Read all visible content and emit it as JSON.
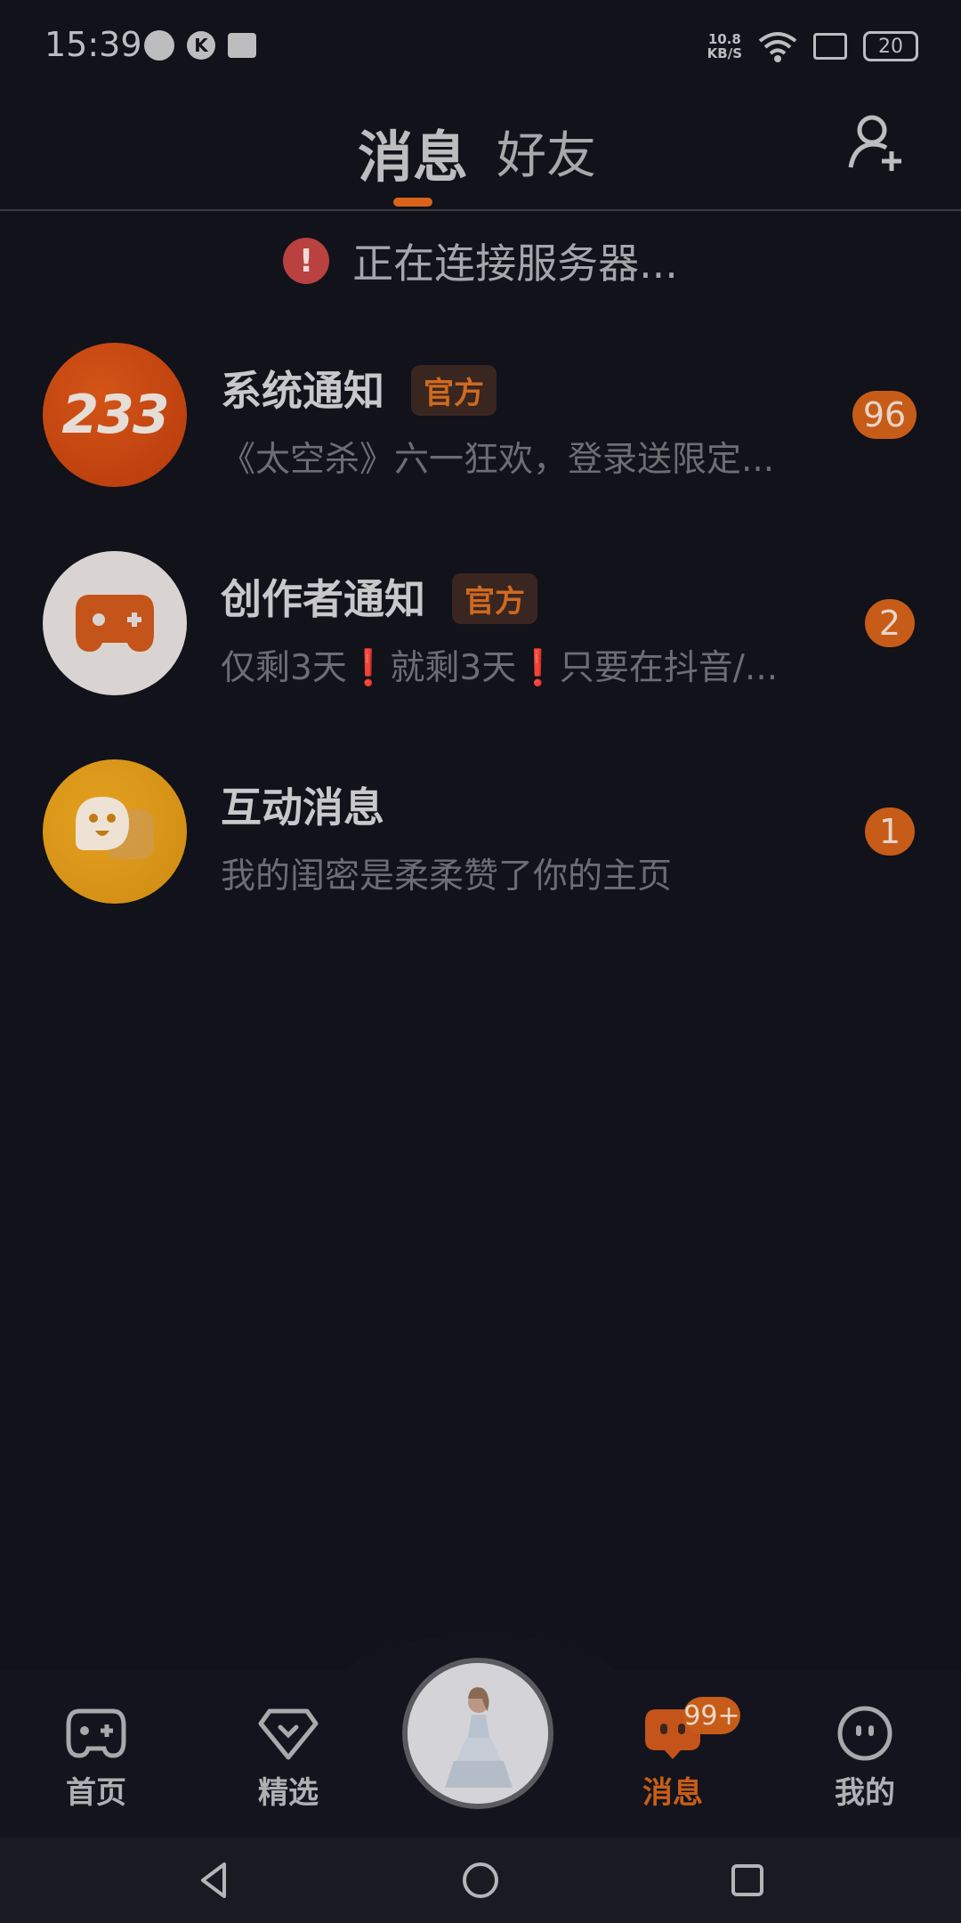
{
  "status_bar": {
    "time": "15:39",
    "k_icon_text": "K",
    "net_speed_value": "10.8",
    "net_speed_unit": "KB/S",
    "battery": "20"
  },
  "header": {
    "tab_messages": "消息",
    "tab_friends": "好友",
    "active_tab": "消息",
    "add_friend_icon": "add-person-icon"
  },
  "banner": {
    "icon_text": "!",
    "text": "正在连接服务器..."
  },
  "messages": [
    {
      "avatar_text": "233",
      "title": "系统通知",
      "tag": "官方",
      "preview": "《太空杀》六一狂欢，登录送限定...",
      "count": "96"
    },
    {
      "avatar_icon": "gamepad-icon",
      "title": "创作者通知",
      "tag": "官方",
      "preview_part1": "仅剩3天",
      "preview_mark1": "❗",
      "preview_part2": "就剩3天",
      "preview_mark2": "❗",
      "preview_part3": "只要在抖音/...",
      "count": "2"
    },
    {
      "avatar_icon": "chat-face-icon",
      "title": "互动消息",
      "preview": "我的闺密是柔柔赞了你的主页",
      "count": "1"
    }
  ],
  "bottom_nav": {
    "home": "首页",
    "featured": "精选",
    "messages": "消息",
    "messages_badge": "99+",
    "mine": "我的"
  },
  "colors": {
    "background": "#11121a",
    "accent": "#c95e17",
    "warning": "#b9413f"
  }
}
